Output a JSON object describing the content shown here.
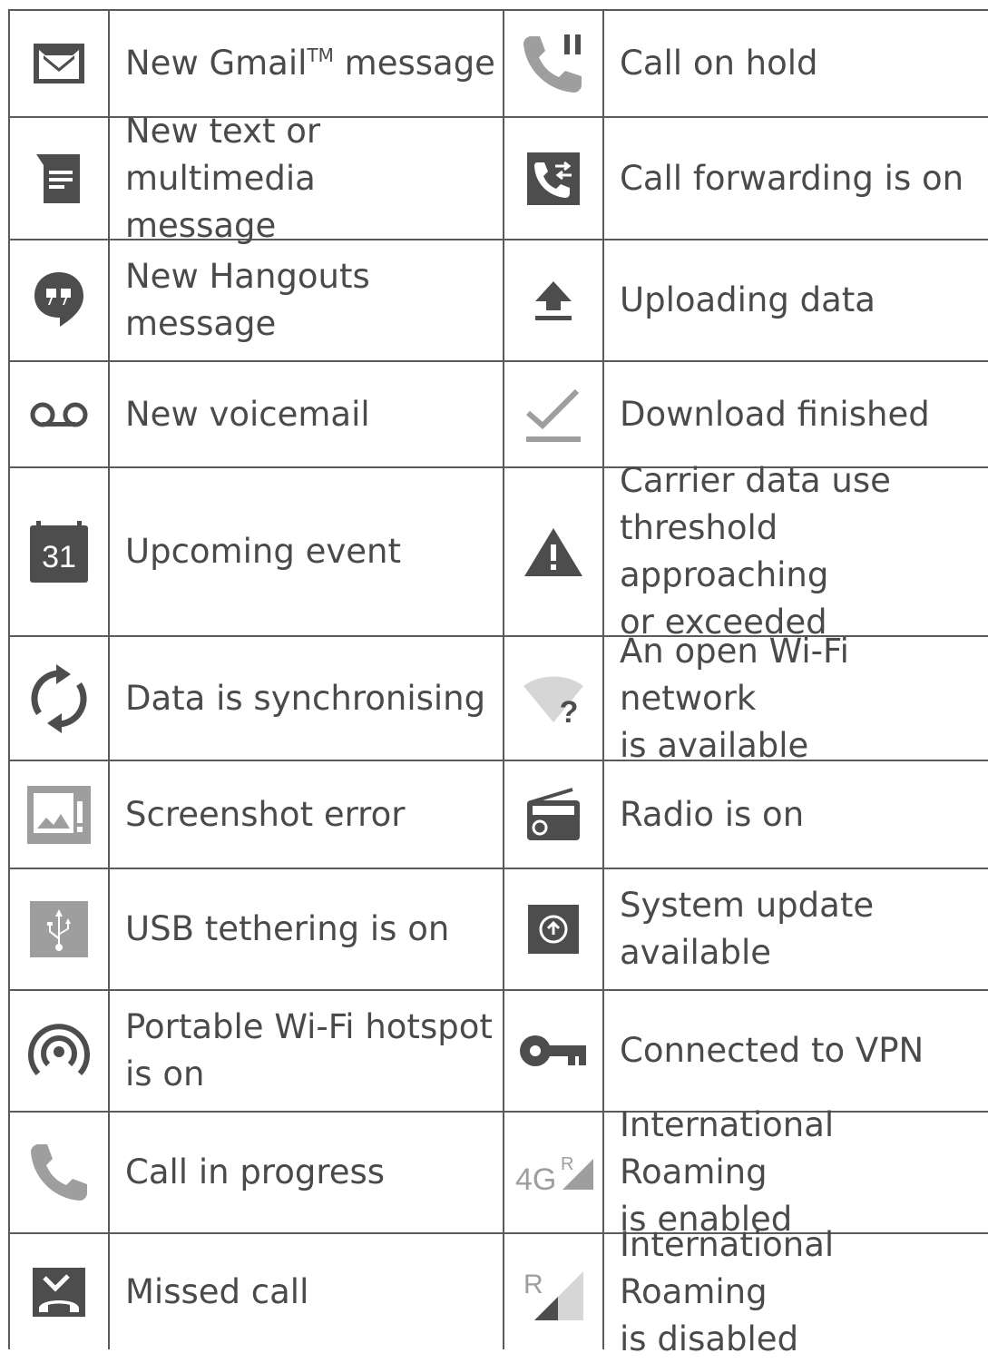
{
  "left": [
    {
      "icon": "gmail-icon",
      "label": "New Gmail",
      "label_sup": "TM",
      "label_after": " message"
    },
    {
      "icon": "text-message-icon",
      "label": "New text or multimedia\nmessage"
    },
    {
      "icon": "hangouts-icon",
      "label": "New Hangouts\nmessage"
    },
    {
      "icon": "voicemail-icon",
      "label": "New voicemail"
    },
    {
      "icon": "calendar-icon",
      "label": "Upcoming event",
      "calendar_day": "31"
    },
    {
      "icon": "sync-icon",
      "label": "Data is synchronising"
    },
    {
      "icon": "screenshot-error-icon",
      "label": "Screenshot error"
    },
    {
      "icon": "usb-icon",
      "label": "USB tethering is on"
    },
    {
      "icon": "hotspot-icon",
      "label": "Portable Wi-Fi hotspot\nis on"
    },
    {
      "icon": "phone-icon",
      "label": "Call in progress"
    },
    {
      "icon": "missed-call-icon",
      "label": "Missed call"
    }
  ],
  "right": [
    {
      "icon": "call-hold-icon",
      "label": "Call on hold"
    },
    {
      "icon": "call-forward-icon",
      "label": "Call forwarding is on"
    },
    {
      "icon": "upload-icon",
      "label": "Uploading data"
    },
    {
      "icon": "download-done-icon",
      "label": "Download finished"
    },
    {
      "icon": "warning-icon",
      "label": "Carrier data use\nthreshold approaching\nor exceeded"
    },
    {
      "icon": "wifi-question-icon",
      "label": "An open Wi-Fi network\nis available"
    },
    {
      "icon": "radio-icon",
      "label": "Radio is on"
    },
    {
      "icon": "system-update-icon",
      "label": "System update\navailable"
    },
    {
      "icon": "vpn-key-icon",
      "label": "Connected to VPN"
    },
    {
      "icon": "roaming-4g-icon",
      "label": "International Roaming\nis enabled",
      "icon_text": "4G",
      "icon_sup": "R"
    },
    {
      "icon": "roaming-disabled-icon",
      "label": "International Roaming\nis disabled",
      "icon_sup": "R"
    }
  ],
  "colors": {
    "icon_dark": "#4d4d4d",
    "icon_light": "#9e9e9e",
    "line": "#5a5a5a",
    "text": "#4a4a4a"
  }
}
